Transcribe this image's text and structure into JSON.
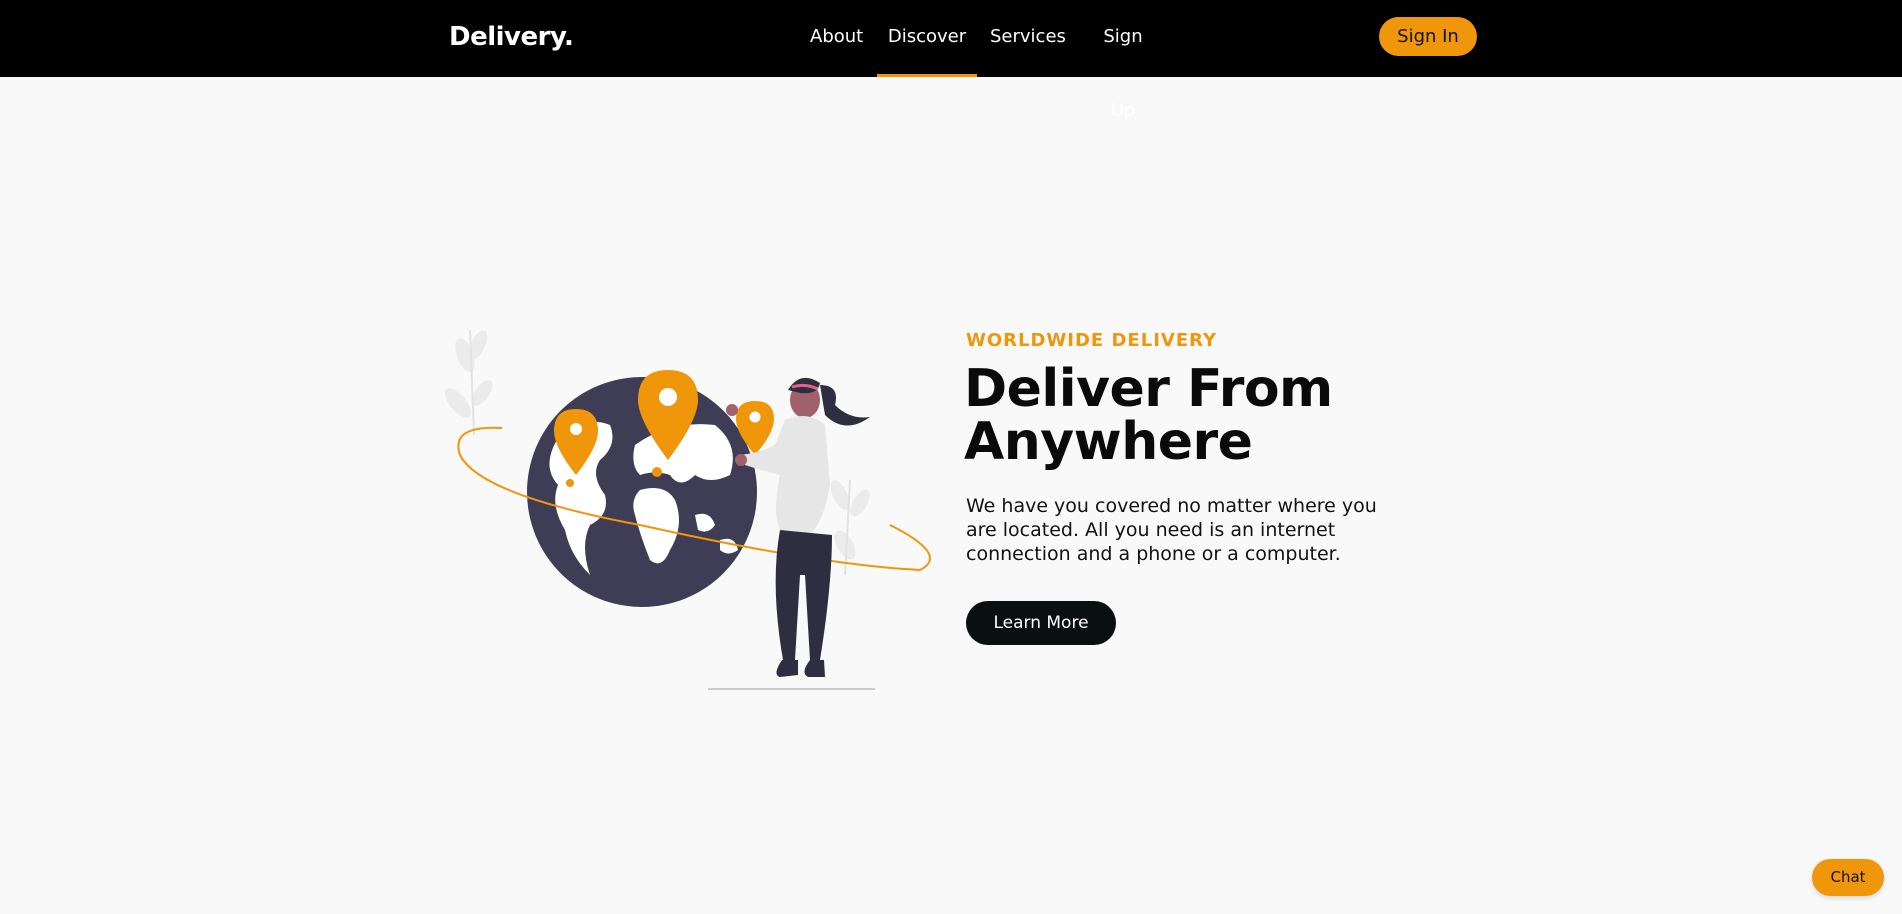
{
  "brand": {
    "logo_text": "Delivery.",
    "accent_color": "#f0960a"
  },
  "nav": {
    "items": [
      {
        "label": "About",
        "active": false
      },
      {
        "label": "Discover",
        "active": true
      },
      {
        "label": "Services",
        "active": false
      },
      {
        "label": "Sign Up",
        "active": false
      }
    ],
    "signin_label": "Sign In"
  },
  "hero": {
    "eyebrow": "WORLDWIDE DELIVERY",
    "title": "Deliver From Anywhere",
    "description": "We have you covered no matter where you are located. All you need is an internet connection and a phone or a computer.",
    "cta_label": "Learn More",
    "illustration_icon": "globe-with-location-pins"
  },
  "chat": {
    "label": "Chat"
  }
}
